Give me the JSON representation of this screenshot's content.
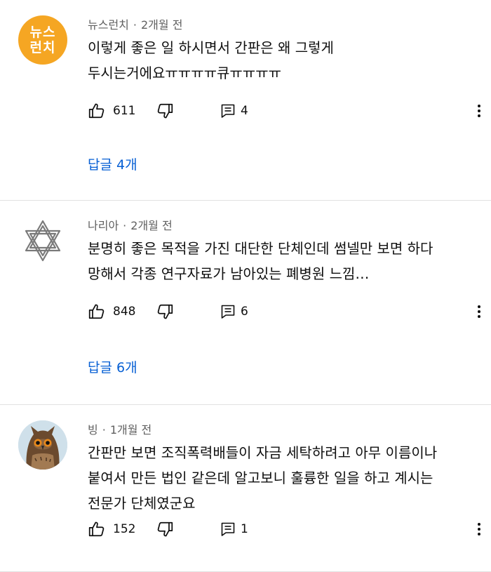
{
  "comments": [
    {
      "author": "뉴스런치",
      "time": "2개월 전",
      "avatar_text": [
        "뉴스",
        "런치"
      ],
      "lines": [
        "이렇게 좋은 일 하시면서 간판은 왜 그렇게",
        "두시는거에요ㅠㅠㅠㅠ큐ㅠㅠㅠㅠ"
      ],
      "likes": "611",
      "replies": "4",
      "replies_link": "답글 4개"
    },
    {
      "author": "나리아",
      "time": "2개월 전",
      "lines": [
        "분명히 좋은 목적을 가진 대단한 단체인데 썸넬만 보면 하다",
        "망해서 각종 연구자료가 남아있는 폐병원 느낌…"
      ],
      "likes": "848",
      "replies": "6",
      "replies_link": "답글 6개"
    },
    {
      "author": "빙",
      "time": "1개월 전",
      "lines": [
        "간판만 보면 조직폭력배들이 자금 세탁하려고 아무 이름이나",
        "붙여서 만든 법인 같은데 알고보니 훌륭한 일을 하고 계시는",
        "전문가 단체였군요"
      ],
      "likes": "152",
      "replies": "1"
    }
  ],
  "separator": "·",
  "colors": {
    "text": "#0f0f0f",
    "meta": "#606060",
    "link": "#065fd4",
    "news_avatar": "#f5a623",
    "divider": "#e2e2e2"
  },
  "icons": {
    "like": "thumbs-up-icon",
    "dislike": "thumbs-down-icon",
    "reply": "comment-icon",
    "more": "more-vertical-icon"
  }
}
